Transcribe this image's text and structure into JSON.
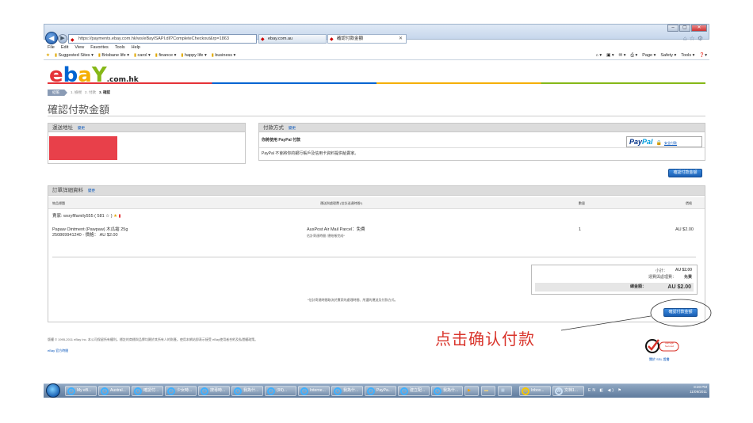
{
  "browser": {
    "url": "https://payments.ebay.com.hk/ws/eBayISAPI.dll?CompleteCheckout&rp=1863",
    "tabs": [
      {
        "label": "ebay.com.au"
      },
      {
        "label": "確認付款金額"
      }
    ],
    "menu": [
      "File",
      "Edit",
      "View",
      "Favorites",
      "Tools",
      "Help"
    ],
    "favorites": [
      "Suggested Sites ▾",
      "Brisbane life ▾",
      "carol ▾",
      "finance ▾",
      "happy life ▾",
      "business ▾"
    ],
    "command_bar": [
      "Page ▾",
      "Safety ▾",
      "Tools ▾"
    ]
  },
  "page": {
    "logo_suffix": ".com.hk",
    "steps": [
      "結帳",
      "1. 檢視",
      "2. 付款",
      "3. 確認"
    ],
    "title": "確認付款金額",
    "edit_label": "變更",
    "shipping": {
      "header": "運送地址"
    },
    "payment": {
      "header": "付款方式",
      "line1": "你將使用 PayPal 付款",
      "line2": "PayPal 不會將你的銀行帳戶及信用卡資料提供給賣家。",
      "paypal_a": "Pay",
      "paypal_b": "Pal",
      "secure_note": "安全付款"
    },
    "confirm_button": "確認付款金額",
    "order": {
      "header": "訂單詳細資料",
      "col_item": "物品標題",
      "col_shipping": "運送與處理費 (估計送達時間*)",
      "col_qty": "數量",
      "col_price": "價格",
      "seller": "賣家: wsryflfamily555 ( 581 ☆ )",
      "item_title": "Papaw Ointment (Pawpaw) 木瓜霜 25g",
      "item_id": "250869941240 - 價格：  AU $2.00",
      "shipping_method": "AusPost Air Mail Parcel：免費",
      "shipping_eta": "估計寄達時間: 總結帳完成*",
      "qty": "1",
      "price": "AU $2.00"
    },
    "summary": {
      "subtotal_label": "小計：",
      "subtotal_value": "AU $2.00",
      "shipping_label": "運費與處理費：",
      "shipping_value": "免費",
      "total_label": "總金額：",
      "total_value": "AU $2.00"
    },
    "note": "*估計寄達時間取決於賣家的處理時間、所選的運送及付款方式。",
    "footer": "版權 © 1995-2011 eBay Inc. 本公司保留所有權利。標註的商標與品牌均屬於其所有人的財產。使用本網站即表示接受 eBay使用者合約及私隱權政策。",
    "footer_link": "eBay 官方時間",
    "verisign": "VeriSign Secured",
    "verisign_link": "關於 SSL 證書"
  },
  "annotation": "点击确认付款",
  "taskbar": {
    "items": [
      "My eB...",
      "Austral...",
      "確認付...",
      "少女時...",
      "搜尋時...",
      "我為什...",
      "(99)...",
      "Interne...",
      "我為什...",
      "PayPa...",
      "建立配...",
      "我為什..."
    ],
    "extra_items": [
      "Inbox...",
      "文档1..."
    ],
    "time": "8:20 PM",
    "date": "11/09/2011"
  }
}
